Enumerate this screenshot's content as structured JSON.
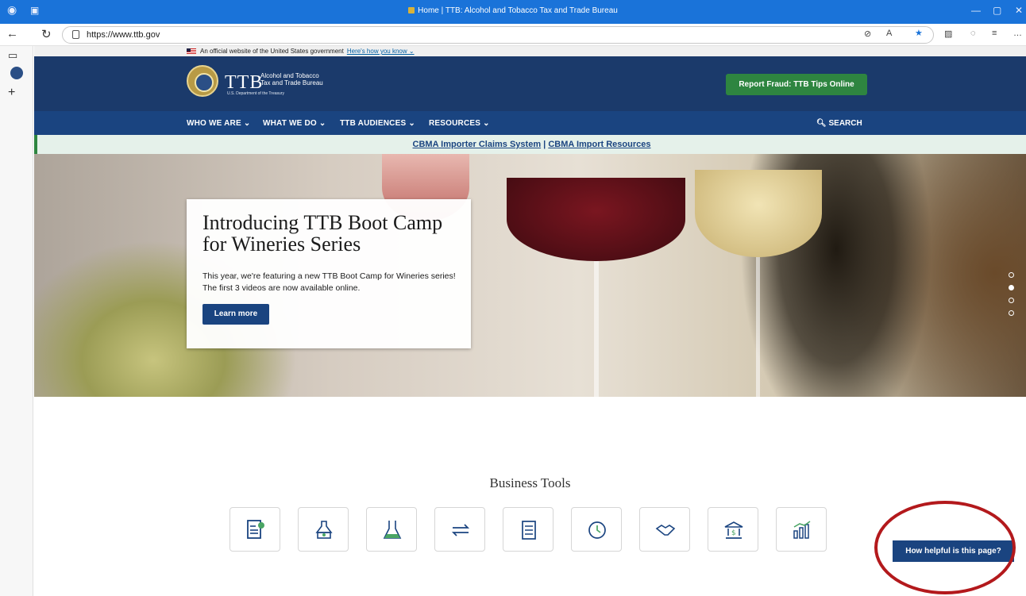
{
  "browser": {
    "tab_title": "Home | TTB: Alcohol and Tobacco Tax and Trade Bureau",
    "url": "https://www.ttb.gov",
    "window_controls": [
      "—",
      "▢",
      "✕"
    ]
  },
  "gov_banner": {
    "text": "An official website of the United States government",
    "link": "Here's how you know ⌄"
  },
  "header": {
    "logo_abbr": "TTB",
    "logo_line1": "Alcohol and Tobacco",
    "logo_line2": "Tax and Trade Bureau",
    "logo_dept": "U.S. Department of the Treasury",
    "cta_button": "Report Fraud: TTB Tips Online"
  },
  "nav": {
    "items": [
      "WHO WE ARE ⌄",
      "WHAT WE DO ⌄",
      "TTB AUDIENCES ⌄",
      "RESOURCES ⌄"
    ],
    "search": "SEARCH"
  },
  "alert": {
    "link1": "CBMA Importer Claims System",
    "separator": " | ",
    "link2": "CBMA Import Resources"
  },
  "carousel": {
    "title": "Introducing TTB Boot Camp for Wineries Series",
    "body": "This year, we're featuring a new TTB Boot Camp for Wineries series! The first 3 videos are now available online.",
    "button": "Learn more",
    "slide_count": 4,
    "active_slide": 2
  },
  "business_tools": {
    "title": "Business Tools",
    "icons": [
      "permit-icon",
      "still-icon",
      "lab-flask-icon",
      "exchange-icon",
      "documents-icon",
      "clock-icon",
      "handshake-icon",
      "treasury-icon",
      "statistics-icon"
    ]
  },
  "feedback": {
    "button": "How helpful is this page?"
  },
  "colors": {
    "header_navy": "#1b3a6b",
    "nav_blue": "#1a4480",
    "fraud_green": "#2e8540",
    "annotation_red": "#b3191c"
  }
}
